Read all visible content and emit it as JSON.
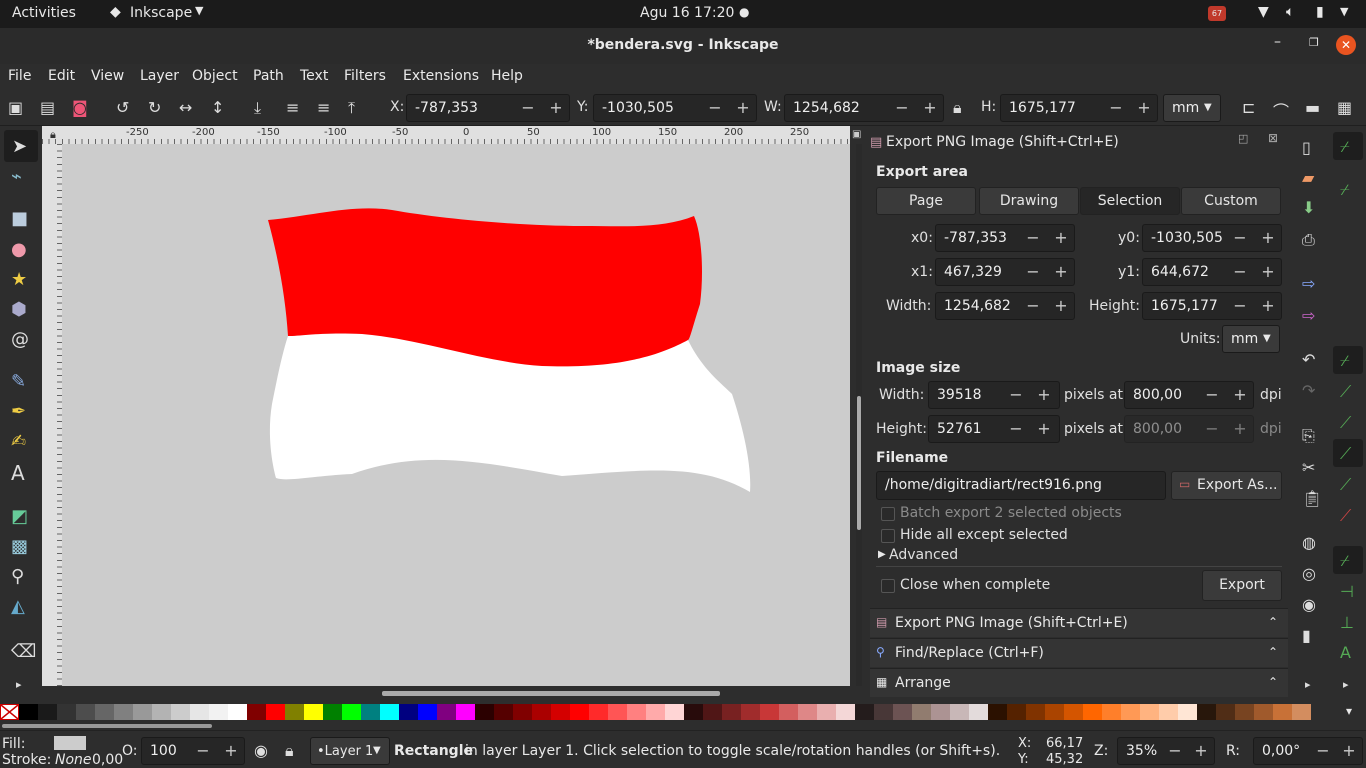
{
  "topbar": {
    "activities": "Activities",
    "app_menu": "Inkscape",
    "datetime": "Agu 16  17:20",
    "notif_badge": "67"
  },
  "titlebar": {
    "title": "*bendera.svg - Inkscape"
  },
  "menu": [
    "File",
    "Edit",
    "View",
    "Layer",
    "Object",
    "Path",
    "Text",
    "Filters",
    "Extensions",
    "Help"
  ],
  "toolbar": {
    "x_label": "X:",
    "x_value": "-787,353",
    "y_label": "Y:",
    "y_value": "-1030,505",
    "w_label": "W:",
    "w_value": "1254,682",
    "h_label": "H:",
    "h_value": "1675,177",
    "unit": "mm"
  },
  "ruler": {
    "ticks": [
      "-250",
      "-200",
      "-150",
      "-100",
      "-50",
      "0",
      "50",
      "100",
      "150",
      "200",
      "250"
    ]
  },
  "export_dialog": {
    "header": "Export PNG Image (Shift+Ctrl+E)",
    "export_area_title": "Export area",
    "area_buttons": [
      "Page",
      "Drawing",
      "Selection",
      "Custom"
    ],
    "x0_label": "x0:",
    "x0": "-787,353",
    "y0_label": "y0:",
    "y0": "-1030,505",
    "x1_label": "x1:",
    "x1": "467,329",
    "y1_label": "y1:",
    "y1": "644,672",
    "width_label": "Width:",
    "width": "1254,682",
    "height_label": "Height:",
    "height": "1675,177",
    "units_label": "Units:",
    "units": "mm",
    "image_size_title": "Image size",
    "img_width_label": "Width:",
    "img_width": "39518",
    "img_height_label": "Height:",
    "img_height": "52761",
    "pixels_at": "pixels at",
    "dpi_value": "800,00",
    "dpi_value2": "800,00",
    "dpi": "dpi",
    "filename_title": "Filename",
    "filename": "/home/digitradiart/rect916.png",
    "export_as": "Export As...",
    "batch_export": "Batch export 2 selected objects",
    "hide_all": "Hide all except selected",
    "advanced": "Advanced",
    "close_when_complete": "Close when complete",
    "export_button": "Export"
  },
  "docked_panels": [
    "Export PNG Image (Shift+Ctrl+E)",
    "Find/Replace (Ctrl+F)",
    "Arrange"
  ],
  "statusbar": {
    "fill_label": "Fill:",
    "stroke_label": "Stroke:",
    "stroke_value": "None",
    "stroke_width": "0,00",
    "opacity_label": "O:",
    "opacity_value": "100",
    "layer": "•Layer 1",
    "message_bold": "Rectangle",
    "message": " in layer Layer 1. Click selection to toggle scale/rotation handles (or Shift+s).",
    "cursor_x_label": "X:",
    "cursor_x": "66,17",
    "cursor_y_label": "Y:",
    "cursor_y": "45,32",
    "zoom_label": "Z:",
    "zoom": "35%",
    "rotate_label": "R:",
    "rotate": "0,00°"
  },
  "colors": {
    "flag_red": "#ff0000",
    "flag_white": "#ffffff",
    "canvas_bg": "#cccccc"
  },
  "palette": [
    "#000000",
    "#1a1a1a",
    "#333333",
    "#4d4d4d",
    "#666666",
    "#808080",
    "#999999",
    "#b3b3b3",
    "#cccccc",
    "#e6e6e6",
    "#f2f2f2",
    "#ffffff",
    "#800000",
    "#ff0000",
    "#808000",
    "#ffff00",
    "#008000",
    "#00ff00",
    "#008080",
    "#00ffff",
    "#000080",
    "#0000ff",
    "#800080",
    "#ff00ff",
    "#2b0000",
    "#550000",
    "#800000",
    "#aa0000",
    "#d40000",
    "#ff0000",
    "#ff2a2a",
    "#ff5555",
    "#ff8080",
    "#ffaaaa",
    "#ffd5d5",
    "#280b0b",
    "#501616",
    "#782121",
    "#a02c2c",
    "#c83737",
    "#d35f5f",
    "#de8787",
    "#e9afaf",
    "#f4d7d7",
    "#241c1c",
    "#483737",
    "#6c5353",
    "#917c6f",
    "#ac9393",
    "#c8b7b7",
    "#e3dbdb",
    "#2b1100",
    "#552200",
    "#803300",
    "#aa4400",
    "#d45500",
    "#ff6600",
    "#ff7f2a",
    "#ff9955",
    "#ffb380",
    "#ffccaa",
    "#ffe6d5",
    "#28170b",
    "#502d16",
    "#784421",
    "#a05a2c",
    "#c87137",
    "#d38d5f"
  ]
}
